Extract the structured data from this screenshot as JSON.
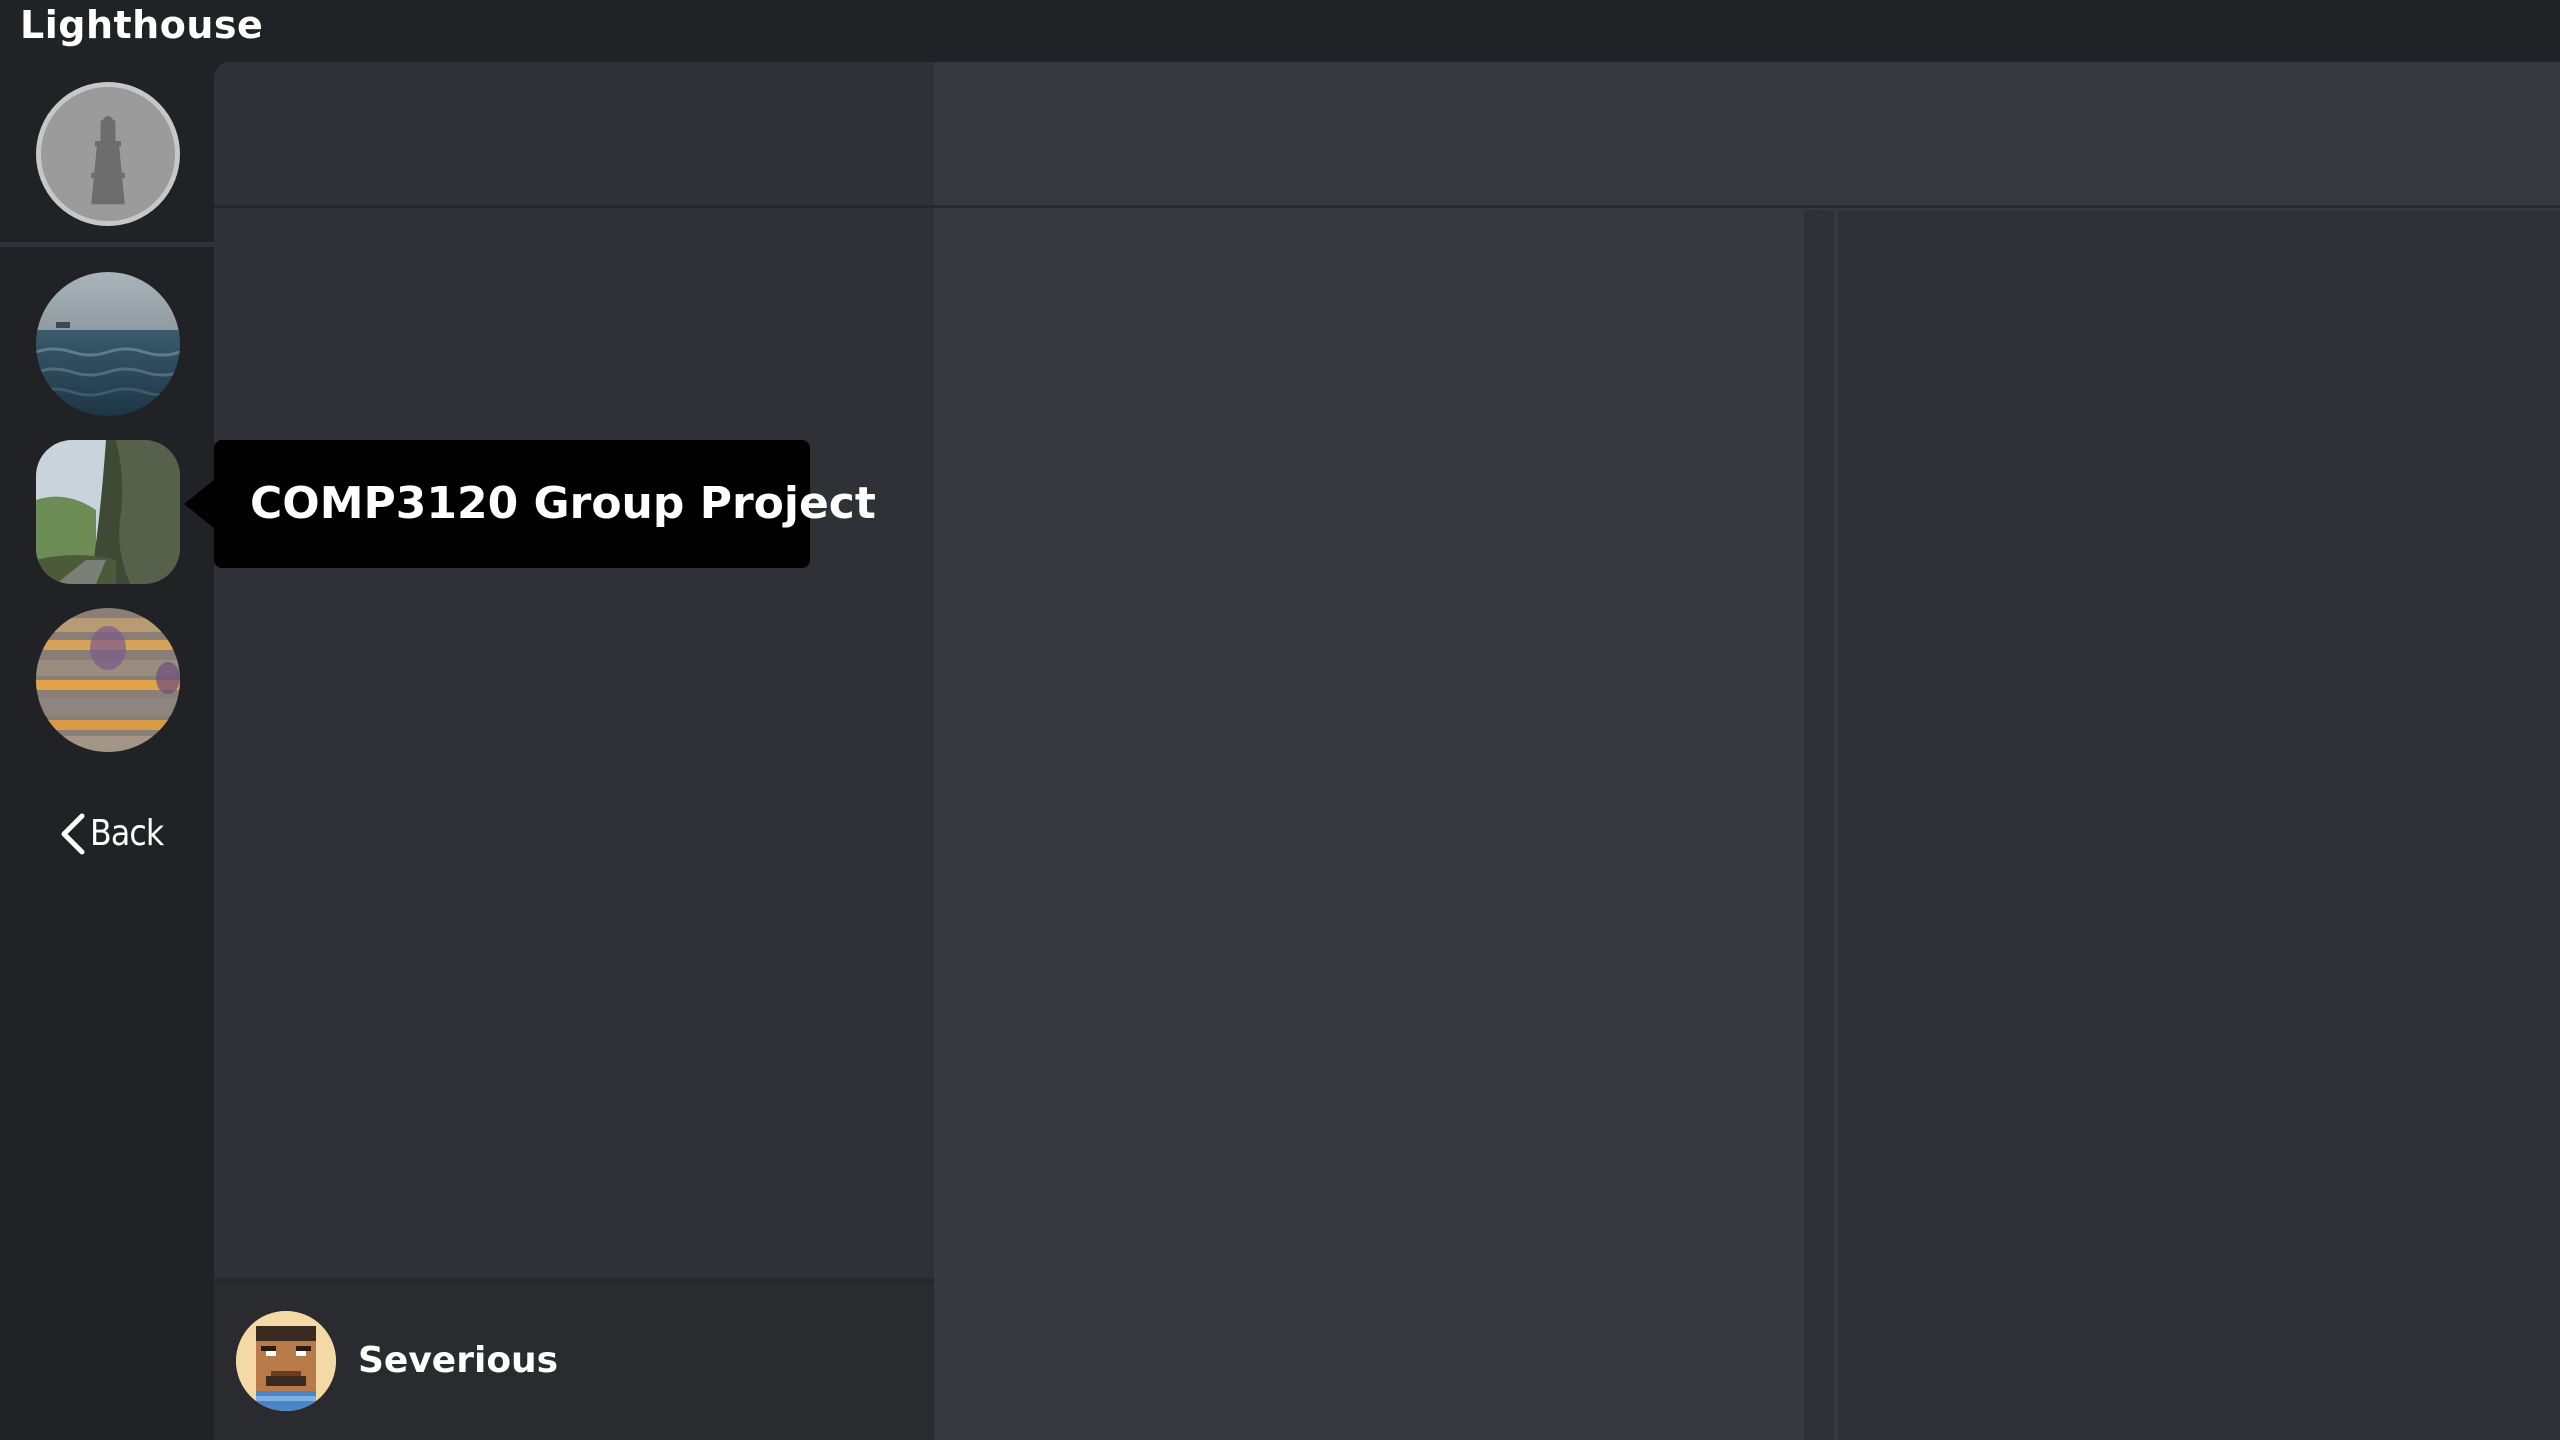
{
  "app": {
    "title": "Lighthouse"
  },
  "servers": [
    {
      "id": "home",
      "icon": "lighthouse-icon"
    },
    {
      "id": "server-ocean",
      "icon": "ocean-image"
    },
    {
      "id": "server-comp3120",
      "icon": "cliff-road-image"
    },
    {
      "id": "server-striped",
      "icon": "striped-image"
    }
  ],
  "tooltip": {
    "text": "COMP3120 Group Project"
  },
  "navigation": {
    "back_label": "Back"
  },
  "user": {
    "name": "Severious",
    "avatar_icon": "pixel-avatar"
  },
  "colors": {
    "rail_bg": "#202225",
    "channels_bg": "#2f3136",
    "main_bg": "#36393f",
    "tooltip_bg": "#000000"
  }
}
